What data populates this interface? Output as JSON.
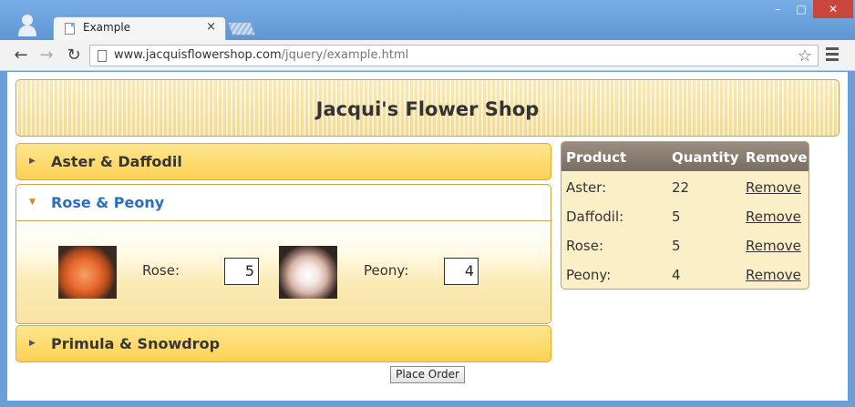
{
  "browser": {
    "tab_title": "Example",
    "tab_close": "×",
    "url_host": "www.jacquisflowershop.com",
    "url_path": "/jquery/example.html",
    "window": {
      "minimize": "–",
      "maximize": "□",
      "close": "✕"
    }
  },
  "page": {
    "title": "Jacqui's Flower Shop",
    "accordion": [
      {
        "label": "Aster & Daffodil"
      },
      {
        "label": "Rose & Peony"
      },
      {
        "label": "Primula & Snowdrop"
      }
    ],
    "products": [
      {
        "label": "Rose:",
        "quantity": "5"
      },
      {
        "label": "Peony:",
        "quantity": "4"
      }
    ],
    "place_order": "Place Order"
  },
  "basket": {
    "headers": {
      "product": "Product",
      "quantity": "Quantity",
      "remove": "Remove"
    },
    "rows": [
      {
        "product": "Aster:",
        "quantity": "22",
        "remove": "Remove"
      },
      {
        "product": "Daffodil:",
        "quantity": "5",
        "remove": "Remove"
      },
      {
        "product": "Rose:",
        "quantity": "5",
        "remove": "Remove"
      },
      {
        "product": "Peony:",
        "quantity": "4",
        "remove": "Remove"
      }
    ]
  }
}
